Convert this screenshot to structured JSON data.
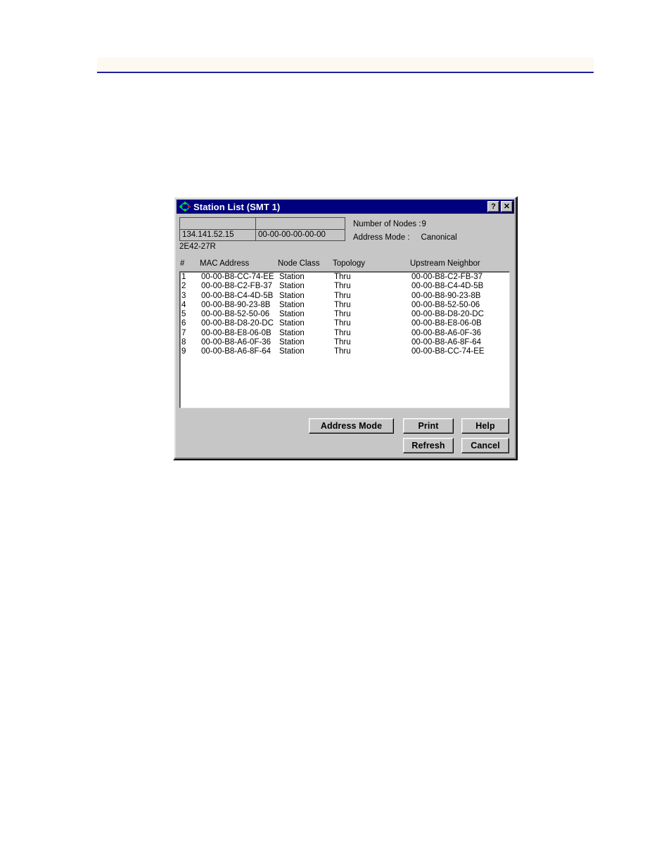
{
  "page": {
    "background": "#ffffff",
    "header_band_color": "#fdf8f0",
    "header_rule_color": "#1f1f9e"
  },
  "dialog": {
    "titlebar": {
      "title": "Station List (SMT 1)",
      "icon": "fddi-ring-icon",
      "color": "#00007e",
      "buttons": [
        {
          "name": "help-titlebar-button",
          "label": "?"
        },
        {
          "name": "close-titlebar-button",
          "label": "✕"
        }
      ]
    },
    "info": {
      "row_top": {
        "col1": "",
        "col2": ""
      },
      "row_bottom": {
        "ip_address": "134.141.52.15",
        "mac_address": "00-00-00-00-00-00"
      },
      "device_label": "2E42-27R"
    },
    "stats": {
      "nodes_label": "Number of Nodes :",
      "nodes_value": "9",
      "address_mode_label": "Address Mode :",
      "address_mode_value": "Canonical"
    },
    "table": {
      "columns": [
        "#",
        "MAC Address",
        "Node Class",
        "Topology",
        "Upstream Neighbor"
      ],
      "rows": [
        {
          "num": "1",
          "mac": "00-00-B8-CC-74-EE",
          "class": "Station",
          "topology": "Thru",
          "upstream": "00-00-B8-C2-FB-37"
        },
        {
          "num": "2",
          "mac": "00-00-B8-C2-FB-37",
          "class": "Station",
          "topology": "Thru",
          "upstream": "00-00-B8-C4-4D-5B"
        },
        {
          "num": "3",
          "mac": "00-00-B8-C4-4D-5B",
          "class": "Station",
          "topology": "Thru",
          "upstream": "00-00-B8-90-23-8B"
        },
        {
          "num": "4",
          "mac": "00-00-B8-90-23-8B",
          "class": "Station",
          "topology": "Thru",
          "upstream": "00-00-B8-52-50-06"
        },
        {
          "num": "5",
          "mac": "00-00-B8-52-50-06",
          "class": "Station",
          "topology": "Thru",
          "upstream": "00-00-B8-D8-20-DC"
        },
        {
          "num": "6",
          "mac": "00-00-B8-D8-20-DC",
          "class": "Station",
          "topology": "Thru",
          "upstream": "00-00-B8-E8-06-0B"
        },
        {
          "num": "7",
          "mac": "00-00-B8-E8-06-0B",
          "class": "Station",
          "topology": "Thru",
          "upstream": "00-00-B8-A6-0F-36"
        },
        {
          "num": "8",
          "mac": "00-00-B8-A6-0F-36",
          "class": "Station",
          "topology": "Thru",
          "upstream": "00-00-B8-A6-8F-64"
        },
        {
          "num": "9",
          "mac": "00-00-B8-A6-8F-64",
          "class": "Station",
          "topology": "Thru",
          "upstream": "00-00-B8-CC-74-EE"
        }
      ]
    },
    "buttons": {
      "address_mode": "Address Mode",
      "print": "Print",
      "help": "Help",
      "refresh": "Refresh",
      "cancel": "Cancel"
    }
  }
}
